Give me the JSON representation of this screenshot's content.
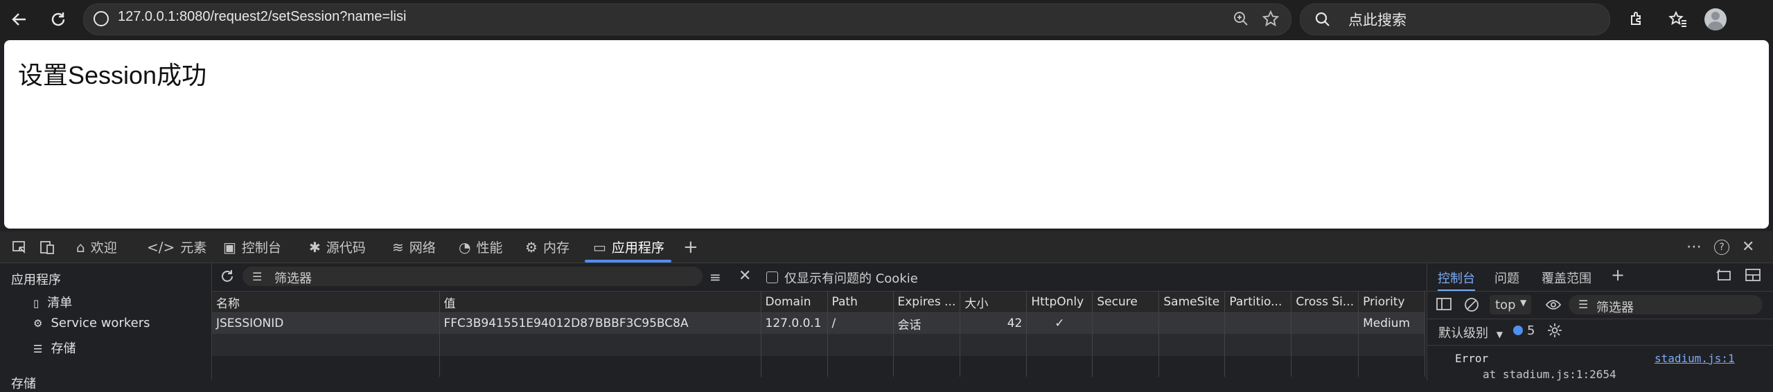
{
  "browser": {
    "url": "127.0.0.1:8080/request2/setSession?name=lisi",
    "search_placeholder": "点此搜索"
  },
  "page": {
    "text": "设置Session成功"
  },
  "devtools": {
    "tabs": [
      {
        "label": "欢迎",
        "icon": "home-icon"
      },
      {
        "label": "元素",
        "icon": "code-icon"
      },
      {
        "label": "控制台",
        "icon": "console-icon"
      },
      {
        "label": "源代码",
        "icon": "bug-icon"
      },
      {
        "label": "网络",
        "icon": "wifi-icon"
      },
      {
        "label": "性能",
        "icon": "gauge-icon"
      },
      {
        "label": "内存",
        "icon": "chip-icon"
      },
      {
        "label": "应用程序",
        "icon": "app-window-icon"
      }
    ],
    "active_tab": "应用程序",
    "left_panel": {
      "title": "应用程序",
      "items": [
        "清单",
        "Service workers",
        "存储"
      ],
      "next_section": "存储"
    },
    "cookies": {
      "filter_placeholder": "筛选器",
      "only_issues_label": "仅显示有问题的 Cookie",
      "columns": [
        "名称",
        "值",
        "Domain",
        "Path",
        "Expires ...",
        "大小",
        "HttpOnly",
        "Secure",
        "SameSite",
        "Partitio...",
        "Cross Si...",
        "Priority"
      ],
      "rows": [
        {
          "name": "JSESSIONID",
          "value": "FFC3B941551E94012D87BBBF3C95BC8A",
          "domain": "127.0.0.1",
          "path": "/",
          "expires": "会话",
          "size": "42",
          "httponly": "✓",
          "secure": "",
          "samesite": "",
          "partition": "",
          "crosssite": "",
          "priority": "Medium"
        }
      ]
    },
    "console": {
      "tabs": [
        "控制台",
        "问题",
        "覆盖范围"
      ],
      "context": "top",
      "filter_placeholder": "筛选器",
      "level": "默认级别",
      "issue_count": "5",
      "error_text": "Error",
      "error_link": "stadium.js:1",
      "error_trace": "at stadium.js:1:2654"
    }
  }
}
